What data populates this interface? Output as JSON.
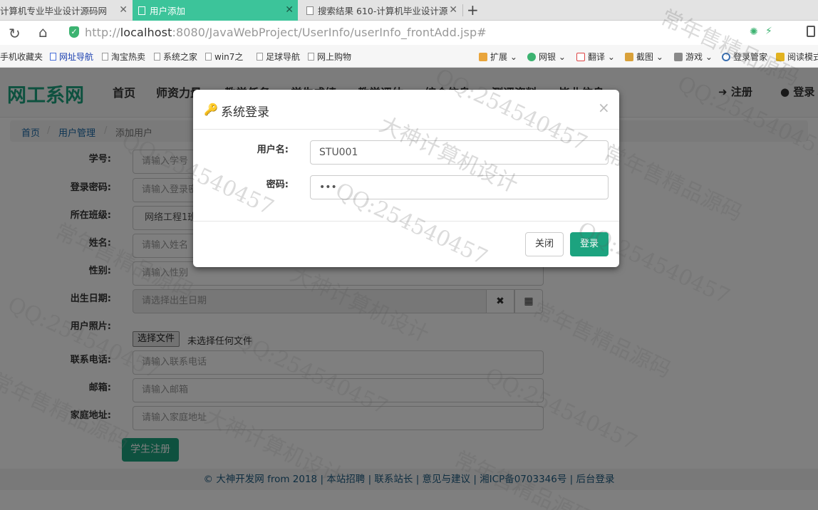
{
  "browser": {
    "tabs": [
      {
        "label": "计算机专业毕业设计源码网"
      },
      {
        "label": "用户添加"
      },
      {
        "label": "搜索结果 610-计算机毕业设计源"
      }
    ],
    "new_tab_label": "+",
    "url_scheme": "http://",
    "url_host": "localhost",
    "url_rest": ":8080/JavaWebProject/UserInfo/userInfo_frontAdd.jsp#",
    "bookmarks_left": [
      "手机收藏夹",
      "网址导航",
      "淘宝热卖",
      "系统之家",
      "win7之",
      "足球导航",
      "网上购物"
    ],
    "bookmarks_right": [
      "扩展",
      "网银",
      "翻译",
      "截图",
      "游戏",
      "登录管家",
      "阅读模式"
    ]
  },
  "site": {
    "brand": "网工系网",
    "nav": [
      "首页",
      "师资力量",
      "教学任务",
      "学生成绩",
      "教学评估",
      "综合信息",
      "测评资料",
      "毕业信息"
    ],
    "register": "注册",
    "login": "登录",
    "breadcrumb": {
      "home": "首页",
      "section": "用户管理",
      "current": "添加用户"
    }
  },
  "form": {
    "fields": [
      {
        "label": "学号:",
        "placeholder": "请输入学号"
      },
      {
        "label": "登录密码:",
        "placeholder": "请输入登录密码"
      },
      {
        "label": "所在班级:",
        "value": "网络工程1班"
      },
      {
        "label": "姓名:",
        "placeholder": "请输入姓名"
      },
      {
        "label": "性别:",
        "placeholder": "请输入性别"
      },
      {
        "label": "出生日期:",
        "placeholder": "请选择出生日期"
      },
      {
        "label": "用户照片:"
      },
      {
        "label": "联系电话:",
        "placeholder": "请输入联系电话"
      },
      {
        "label": "邮箱:",
        "placeholder": "请输入邮箱"
      },
      {
        "label": "家庭地址:",
        "placeholder": "请输入家庭地址"
      }
    ],
    "file_button": "选择文件",
    "file_status": "未选择任何文件",
    "submit": "学生注册"
  },
  "footer": "© 大神开发网 from 2018 | 本站招聘 | 联系站长 | 意见与建议 | 湘ICP备0703346号 | 后台登录",
  "modal": {
    "title": "系统登录",
    "close_symbol": "×",
    "username_label": "用户名:",
    "username_value": "STU001",
    "password_label": "密码:",
    "password_value": "•••",
    "close_button": "关闭",
    "login_button": "登录"
  },
  "watermark": {
    "a": "大神计算机设计",
    "b": "QQ:254540457",
    "c": "常年售精品源码"
  }
}
